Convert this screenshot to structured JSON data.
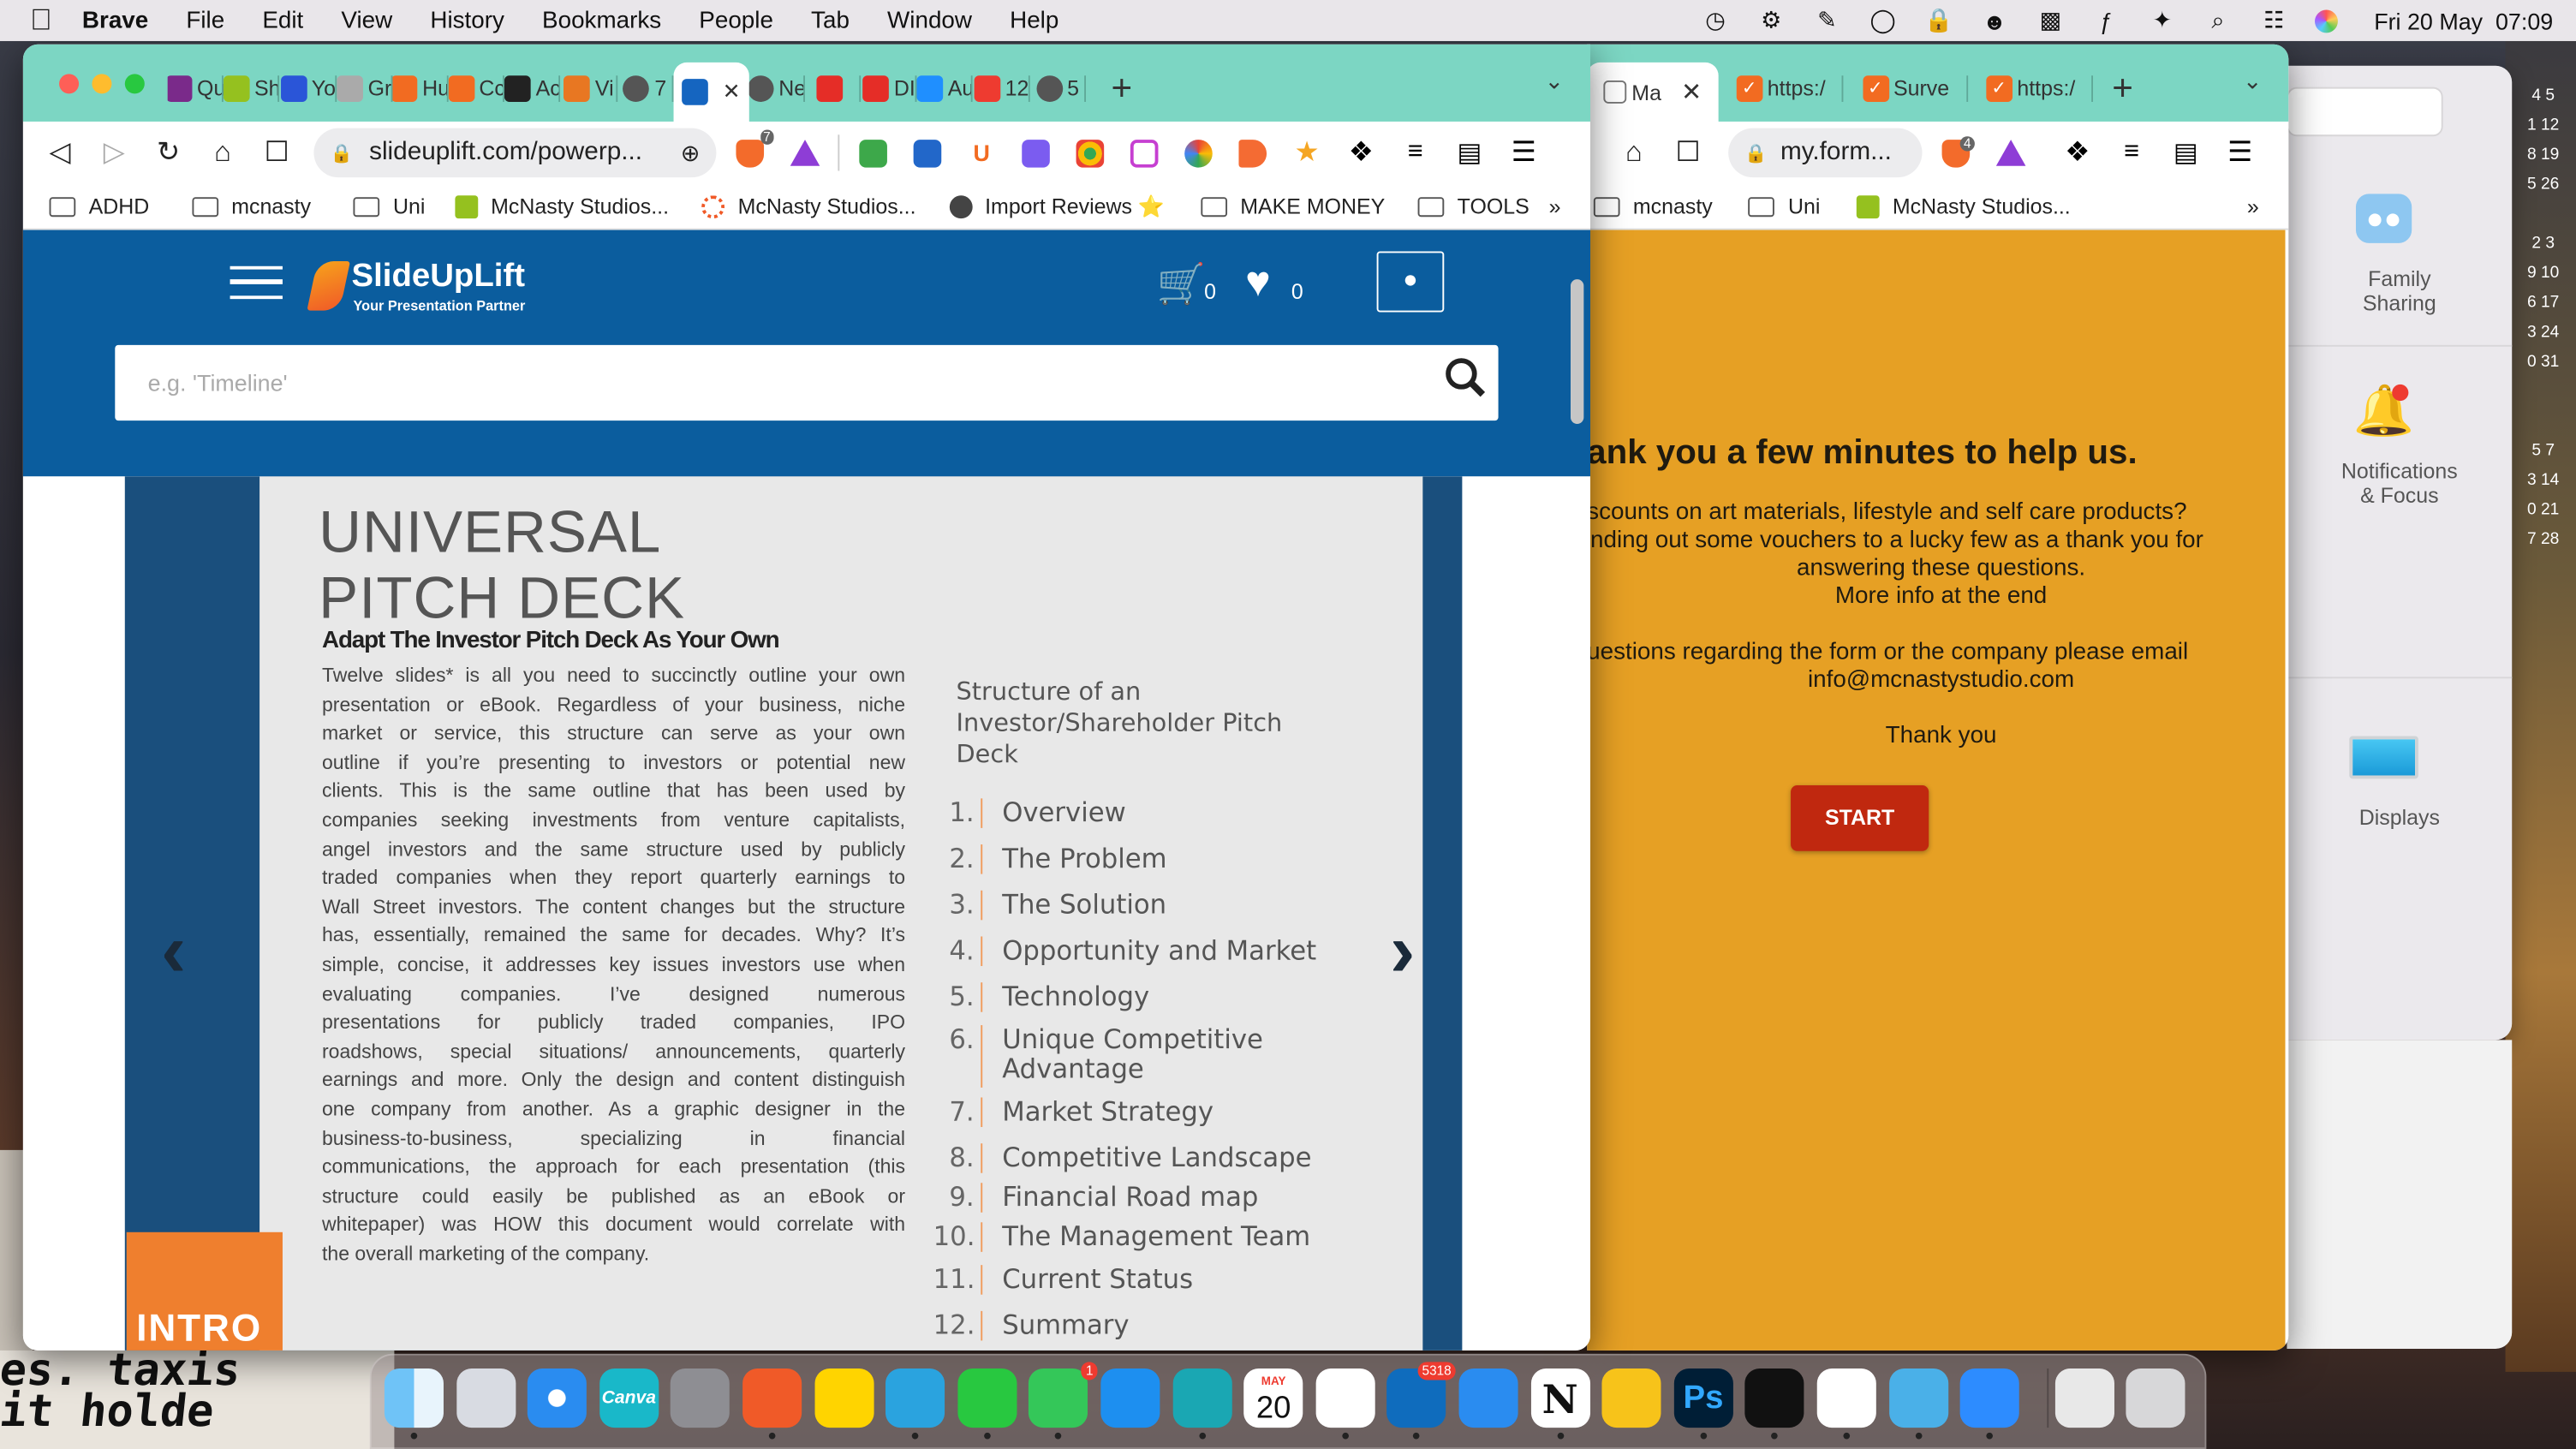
{
  "menubar": {
    "app_name": "Brave",
    "items": [
      "File",
      "Edit",
      "View",
      "History",
      "Bookmarks",
      "People",
      "Tab",
      "Window",
      "Help"
    ],
    "clock": "Fri 20 May  07:09"
  },
  "left_browser": {
    "tabs": [
      "Qu",
      "Sh",
      "Yo",
      "Gr",
      "Hu",
      "Cc",
      "Ac",
      "Vi",
      "7",
      "",
      "Ne",
      "",
      "DI",
      "Au",
      "12",
      "5"
    ],
    "address": "slideuplift.com/powerp...",
    "shields_count": "7",
    "bookmarks": [
      "ADHD",
      "mcnasty",
      "Uni",
      "McNasty Studios...",
      "McNasty Studios...",
      "Import Reviews ⭐",
      "MAKE MONEY",
      "TOOLS"
    ],
    "bookmarks_more": "»"
  },
  "slideuplift": {
    "logo_name": "SlideUpLift",
    "logo_tagline": "Your Presentation Partner",
    "cart_count": "0",
    "wishlist_count": "0",
    "search_placeholder": "e.g. 'Timeline'"
  },
  "slide": {
    "title_line1": "UNIVERSAL",
    "title_line2": "PITCH DECK",
    "subtitle": "Adapt The Investor Pitch Deck As Your Own",
    "body_lines": [
      "Twelve slides* is all you need to succinctly outline your own",
      "presentation or eBook. Regardless of your business, niche",
      "market or service, this structure can serve as your own",
      "outline if you’re presenting to investors or potential new",
      "clients. This is the same outline that has been used by",
      "companies seeking investments from venture capitalists,",
      "angel investors and the same structure used by publicly",
      "traded companies when they report quarterly earnings to",
      "Wall Street investors. The content changes but the structure",
      "has, essentially, remained the same for decades. Why? It’s",
      "simple, concise, it addresses key issues investors use when",
      "evaluating companies. I’ve designed numerous",
      "presentations for publicly traded companies, IPO",
      "roadshows, special situations/ announcements, quarterly",
      "earnings and more. Only the design and content distinguish",
      "one company from another. As a graphic designer in the",
      "business-to-business, specializing in financial",
      "communications, the approach for each presentation (this",
      "structure could easily be published as an eBook or",
      "whitepaper) was HOW this document would correlate with",
      "the overall marketing of the company."
    ],
    "structure_heading_lines": [
      "Structure of an",
      "Investor/Shareholder Pitch",
      "Deck"
    ],
    "toc": [
      {
        "num": "1.",
        "text": "Overview"
      },
      {
        "num": "2.",
        "text": "The Problem"
      },
      {
        "num": "3.",
        "text": "The Solution"
      },
      {
        "num": "4.",
        "text": "Opportunity and Market"
      },
      {
        "num": "5.",
        "text": "Technology"
      },
      {
        "num": "6.",
        "text": "Unique Competitive",
        "text2": "Advantage"
      },
      {
        "num": "7.",
        "text": "Market Strategy"
      },
      {
        "num": "8.",
        "text": "Competitive Landscape"
      },
      {
        "num": "9.",
        "text": "Financial Road map"
      },
      {
        "num": "10.",
        "text": "The Management Team"
      },
      {
        "num": "11.",
        "text": "Current Status"
      },
      {
        "num": "12.",
        "text": "Summary"
      }
    ],
    "corner_label": "INTRO"
  },
  "right_browser": {
    "tabs": [
      "Ma",
      "https:/",
      "Surve",
      "https:/"
    ],
    "address": "my.form...",
    "shields_count": "4",
    "bookmarks": [
      "mcnasty",
      "Uni",
      "McNasty Studios..."
    ],
    "bookmarks_more": "»"
  },
  "survey": {
    "heading": "ank you a few minutes to help us.",
    "line1": "scounts on art materials, lifestyle and self care products?",
    "line2": "nding out some vouchers to a lucky few as a thank you for",
    "line3": "answering these questions.",
    "line4": "More info at the end",
    "line5": "uestions regarding the form or the company please email",
    "email": "info@mcnastystudio.com",
    "thanks": "Thank you",
    "start_label": "START"
  },
  "system_prefs": {
    "items": [
      {
        "label1": "Family",
        "label2": "Sharing"
      },
      {
        "label1": "Notifications",
        "label2": "& Focus"
      },
      {
        "label1": "Displays",
        "label2": ""
      }
    ]
  },
  "calendar_dates": [
    "4 5",
    "1 12",
    "8 19",
    "5 26",
    "",
    "2 3",
    "9 10",
    "6 17",
    "3 24",
    "0 31",
    "",
    "",
    "5 7",
    "3 14",
    "0 21",
    "7 28"
  ],
  "desktop_text": [
    "es. taxis",
    "it holde"
  ],
  "dock": {
    "calendar_month": "MAY",
    "calendar_day": "20",
    "messages_badge": "1",
    "outlook_badge": "5318",
    "canva_label": "Canva",
    "ps_label": "Ps",
    "notion_label": "N"
  },
  "colors": {
    "tabbar": "#7cd6c3",
    "slideuplift_blue": "#0b5d9e",
    "survey_orange": "#e6a024",
    "start_button": "#c0280f",
    "intro_orange": "#ef7f2e"
  }
}
